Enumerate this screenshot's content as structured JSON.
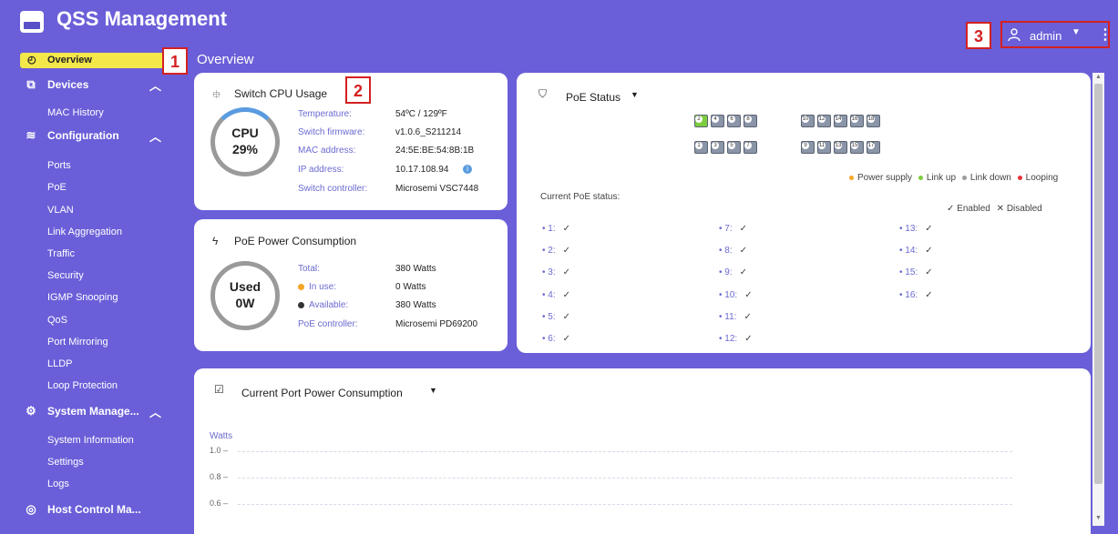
{
  "header": {
    "title": "QSS Management",
    "user": "admin",
    "callouts": [
      "1",
      "2",
      "3"
    ]
  },
  "sidebar": {
    "overview": "Overview",
    "sections": [
      {
        "label": "Devices",
        "icon": "devices-icon",
        "items": [
          "MAC History"
        ]
      },
      {
        "label": "Configuration",
        "icon": "sliders-icon",
        "items": [
          "Ports",
          "PoE",
          "VLAN",
          "Link Aggregation",
          "Traffic",
          "Security",
          "IGMP Snooping",
          "QoS",
          "Port Mirroring",
          "LLDP",
          "Loop Protection"
        ]
      },
      {
        "label": "System Manage...",
        "icon": "gear-icon",
        "items": [
          "System Information",
          "Settings",
          "Logs"
        ]
      },
      {
        "label": "Host Control Ma...",
        "icon": "host-control-icon",
        "items": []
      }
    ]
  },
  "page_title": "Overview",
  "cpu_card": {
    "title": "Switch CPU Usage",
    "gauge_label": "CPU",
    "gauge_value": "29%",
    "gauge_percent": 29,
    "rows": [
      {
        "key": "Temperature:",
        "value": "54ºC / 129ºF"
      },
      {
        "key": "Switch firmware:",
        "value": "v1.0.6_S211214"
      },
      {
        "key": "MAC address:",
        "value": "24:5E:BE:54:8B:1B"
      },
      {
        "key": "IP address:",
        "value": "10.17.108.94"
      },
      {
        "key": "Switch controller:",
        "value": "Microsemi VSC7448"
      }
    ]
  },
  "power_card": {
    "title": "PoE Power Consumption",
    "gauge_label": "Used",
    "gauge_value": "0W",
    "rows": [
      {
        "key": "Total:",
        "value": "380 Watts"
      },
      {
        "key": "In use:",
        "value": "0 Watts"
      },
      {
        "key": "Available:",
        "value": "380 Watts"
      },
      {
        "key": "PoE controller:",
        "value": "Microsemi PD69200"
      }
    ]
  },
  "poe_status": {
    "title": "PoE Status",
    "top_ports": [
      "2",
      "4",
      "6",
      "8",
      "10",
      "12",
      "14",
      "16",
      "18"
    ],
    "bottom_ports": [
      "1",
      "3",
      "5",
      "7",
      "9",
      "11",
      "13",
      "15",
      "17"
    ],
    "legend": {
      "power_supply": "Power supply",
      "link_up": "Link up",
      "link_down": "Link down",
      "looping": "Looping"
    },
    "current_label": "Current PoE status:",
    "enabled": "Enabled",
    "disabled": "Disabled",
    "enabled_mark": "✓",
    "disabled_mark": "✕",
    "entries": [
      "1:",
      "2:",
      "3:",
      "4:",
      "5:",
      "6:",
      "7:",
      "8:",
      "9:",
      "10:",
      "11:",
      "12:",
      "13:",
      "14:",
      "15:",
      "16:"
    ]
  },
  "port_power": {
    "title": "Current Port Power Consumption",
    "unit": "Watts",
    "ticks": [
      "1.0 –",
      "0.8 –",
      "0.6 –"
    ]
  },
  "colors": {
    "background": "#6a5fd8",
    "active_nav": "#f3e74a",
    "callout": "#d42020",
    "power_supply": "#f5a623",
    "link_up": "#7dcc3e",
    "link_down": "#9a9a9a",
    "looping": "#e8333c",
    "gauge": "#9a9a9a",
    "gauge_accent": "#5a9be0"
  }
}
